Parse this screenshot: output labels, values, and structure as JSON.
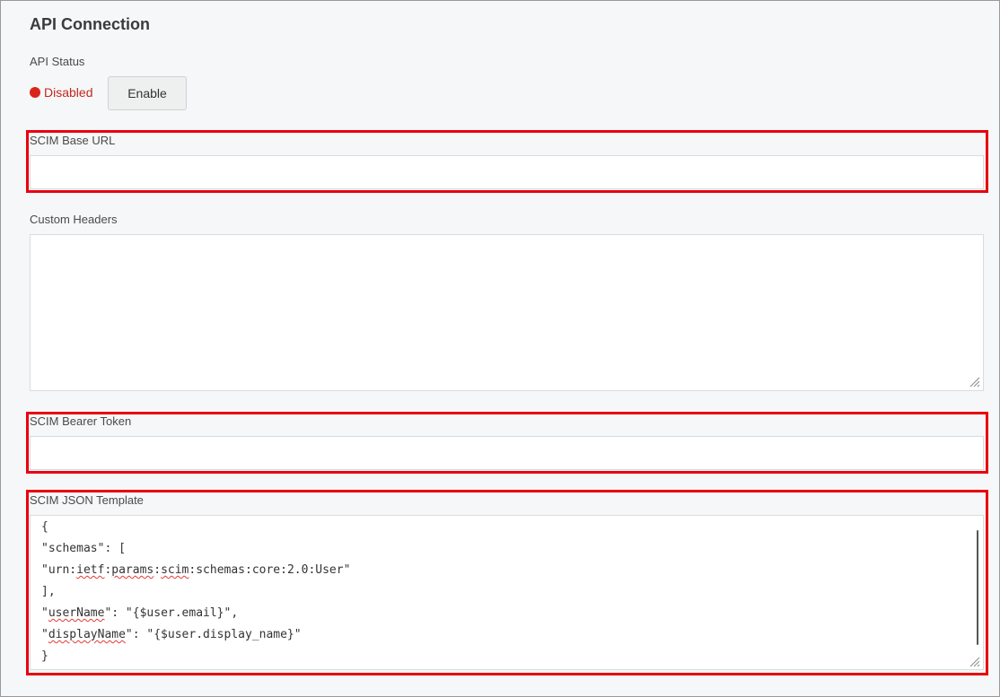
{
  "section": {
    "title": "API Connection"
  },
  "api_status": {
    "label": "API Status",
    "status_text": "Disabled",
    "status_color": "#d9261c",
    "enable_button_label": "Enable"
  },
  "scim_base_url": {
    "label": "SCIM Base URL",
    "value": ""
  },
  "custom_headers": {
    "label": "Custom Headers",
    "value": ""
  },
  "scim_bearer_token": {
    "label": "SCIM Bearer Token",
    "value": ""
  },
  "scim_json_template": {
    "label": "SCIM JSON Template",
    "lines": [
      "{",
      "\"schemas\": [",
      "\"urn:ietf:params:scim:schemas:core:2.0:User\"",
      "],",
      "\"userName\": \"{$user.email}\",",
      "\"displayName\": \"{$user.display_name}\"",
      "}"
    ]
  },
  "colors": {
    "highlight": "#e8000f",
    "background": "#f6f7f8"
  }
}
